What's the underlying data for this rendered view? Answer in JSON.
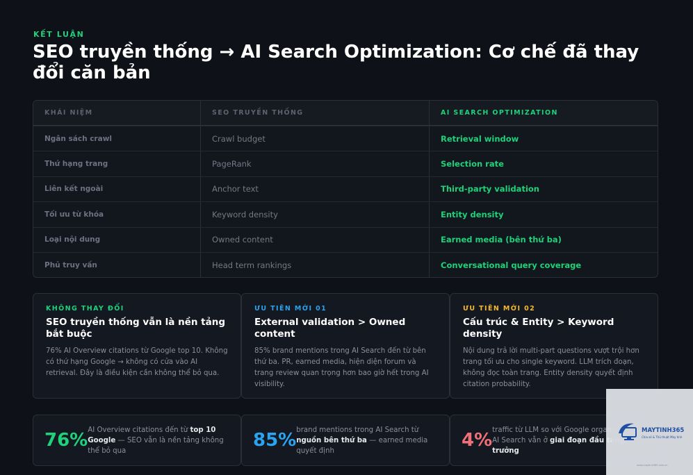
{
  "header": {
    "eyebrow": "KẾT LUẬN",
    "title": "SEO truyền thống → AI Search Optimization: Cơ chế đã thay đổi căn bản"
  },
  "table": {
    "headers": [
      "KHÁI NIỆM",
      "SEO TRUYỀN THỐNG",
      "AI SEARCH OPTIMIZATION"
    ],
    "rows": [
      [
        "Ngân sách crawl",
        "Crawl budget",
        "Retrieval window"
      ],
      [
        "Thứ hạng trang",
        "PageRank",
        "Selection rate"
      ],
      [
        "Liên kết ngoài",
        "Anchor text",
        "Third-party validation"
      ],
      [
        "Tối ưu từ khóa",
        "Keyword density",
        "Entity density"
      ],
      [
        "Loại nội dung",
        "Owned content",
        "Earned media (bên thứ ba)"
      ],
      [
        "Phủ truy vấn",
        "Head term rankings",
        "Conversational query coverage"
      ]
    ]
  },
  "cards": [
    {
      "tag": "KHÔNG THAY ĐỔI",
      "tag_color": "#1fd17a",
      "title": "SEO truyền thống vẫn là nền tảng bắt buộc",
      "body": "76% AI Overview citations từ Google top 10. Không có thứ hạng Google → không có cửa vào AI retrieval. Đây là điều kiện cần không thể bỏ qua."
    },
    {
      "tag": "ƯU TIÊN MỚI 01",
      "tag_color": "#2aa3f0",
      "title": "External validation > Owned content",
      "body": "85% brand mentions trong AI Search đến từ bên thứ ba. PR, earned media, hiện diện forum và trang review quan trọng hơn bao giờ hết trong AI visibility."
    },
    {
      "tag": "ƯU TIÊN MỚI 02",
      "tag_color": "#f5b82e",
      "title": "Cấu trúc & Entity > Keyword density",
      "body": "Nội dung trả lời multi-part questions vượt trội hơn trang tối ưu cho single keyword. LLM trích đoạn, không đọc toàn trang. Entity density quyết định citation probability."
    }
  ],
  "stats": [
    {
      "value": "76%",
      "color": "#1fd17a",
      "pre": "AI Overview citations đến từ ",
      "bold": "top 10 Google",
      "post": " — SEO vẫn là nền tảng không thể bỏ qua"
    },
    {
      "value": "85%",
      "color": "#2aa3f0",
      "pre": "brand mentions trong AI Search từ ",
      "bold": "nguồn bên thứ ba",
      "post": " — earned media quyết định"
    },
    {
      "value": "4%",
      "color": "#f0707a",
      "pre": "traffic từ LLM so với Google organic — AI Search vẫn ở ",
      "bold": "giai đoạn đầu tăng trưởng",
      "post": ""
    }
  ],
  "watermark": {
    "name": "MAYTINH365",
    "sub": "Chia sẻ & Thủ thuật Máy tính",
    "small": "www.maytinh365.com.vn"
  }
}
